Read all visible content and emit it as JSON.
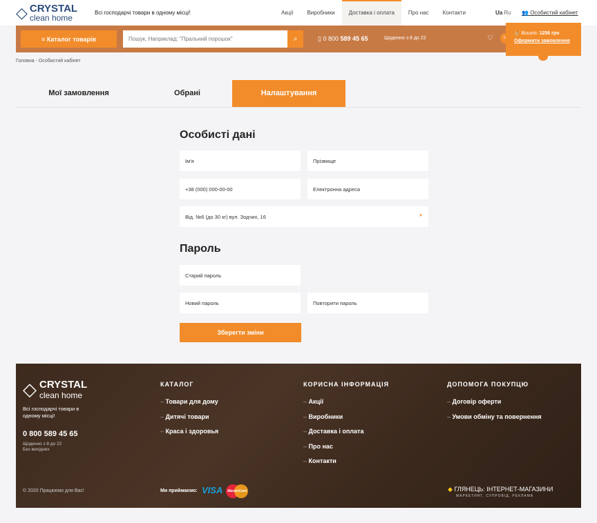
{
  "header": {
    "logo_line1": "CRYSTAL",
    "logo_line2": "clean home",
    "slogan": "Всі господарчі товари в одному місці!",
    "nav": [
      "Акції",
      "Виробники",
      "Доставка і оплата",
      "Про нас",
      "Контакти"
    ],
    "lang_ua": "Ua",
    "lang_ru": "Ru",
    "account": "Особистий кабінет"
  },
  "bar": {
    "catalog": "Каталог товарів",
    "search_placeholder": "Пошук, Наприклад: \"Пральний порошок\"",
    "phone_prefix": "0 800 ",
    "phone_main": "589 45 65",
    "hours": "Щоденно з 8 до 22",
    "wishlist_count": "10",
    "cart_total_label": "Всього:",
    "cart_total": "1256 грн",
    "checkout": "Оформити замовлення"
  },
  "breadcrumb": "Головна - Особистий кабінет",
  "tabs": [
    "Мої замовлення",
    "Обрані",
    "Налаштування"
  ],
  "form": {
    "personal_title": "Особисті дані",
    "first_name": "Ім'я",
    "last_name": "Прізвище",
    "phone": "+38 (000) 000-00-00",
    "email": "Електронна адреса",
    "delivery": "Від. №6 (до 30 кг) вул. Зодчих, 16",
    "password_title": "Пароль",
    "old_password": "Старий пароль",
    "new_password": "Новий пароль",
    "repeat_password": "Повторити пароль",
    "save": "Зберегти зміни"
  },
  "footer": {
    "slogan": "Всі господарчі товари в одному місці!",
    "phone": "0 800 589 45 65",
    "hours": "Щоденно з 8 до 22",
    "days": "Без вихідних",
    "copyright": "© 2020 Працюємо для Вас!",
    "we_accept": "Ми приймаємо:",
    "visa": "VISA",
    "mastercard": "MasterCard",
    "col1_title": "КАТАЛОГ",
    "col1": [
      "Товари для дому",
      "Дитячі товари",
      "Краса і здоровья"
    ],
    "col2_title": "КОРИСНА ІНФОРМАЦІЯ",
    "col2": [
      "Акції",
      "Виробники",
      "Доставка і оплата",
      "Про нас",
      "Контакти"
    ],
    "col3_title": "ДОПОМОГА ПОКУПЦЮ",
    "col3": [
      "Договір оферти",
      "Умови обміну та повернення"
    ],
    "dev": "ГЛЯНЕЦЬ: ІНТЕРНЕТ-МАГАЗИНИ",
    "dev_sub": "МАРКЕТИНГ, СУПРОВІД, РЕКЛАМА"
  },
  "colors": {
    "accent": "#f28c2a",
    "bar": "#c87a45",
    "footer": "#3d2a1e"
  }
}
